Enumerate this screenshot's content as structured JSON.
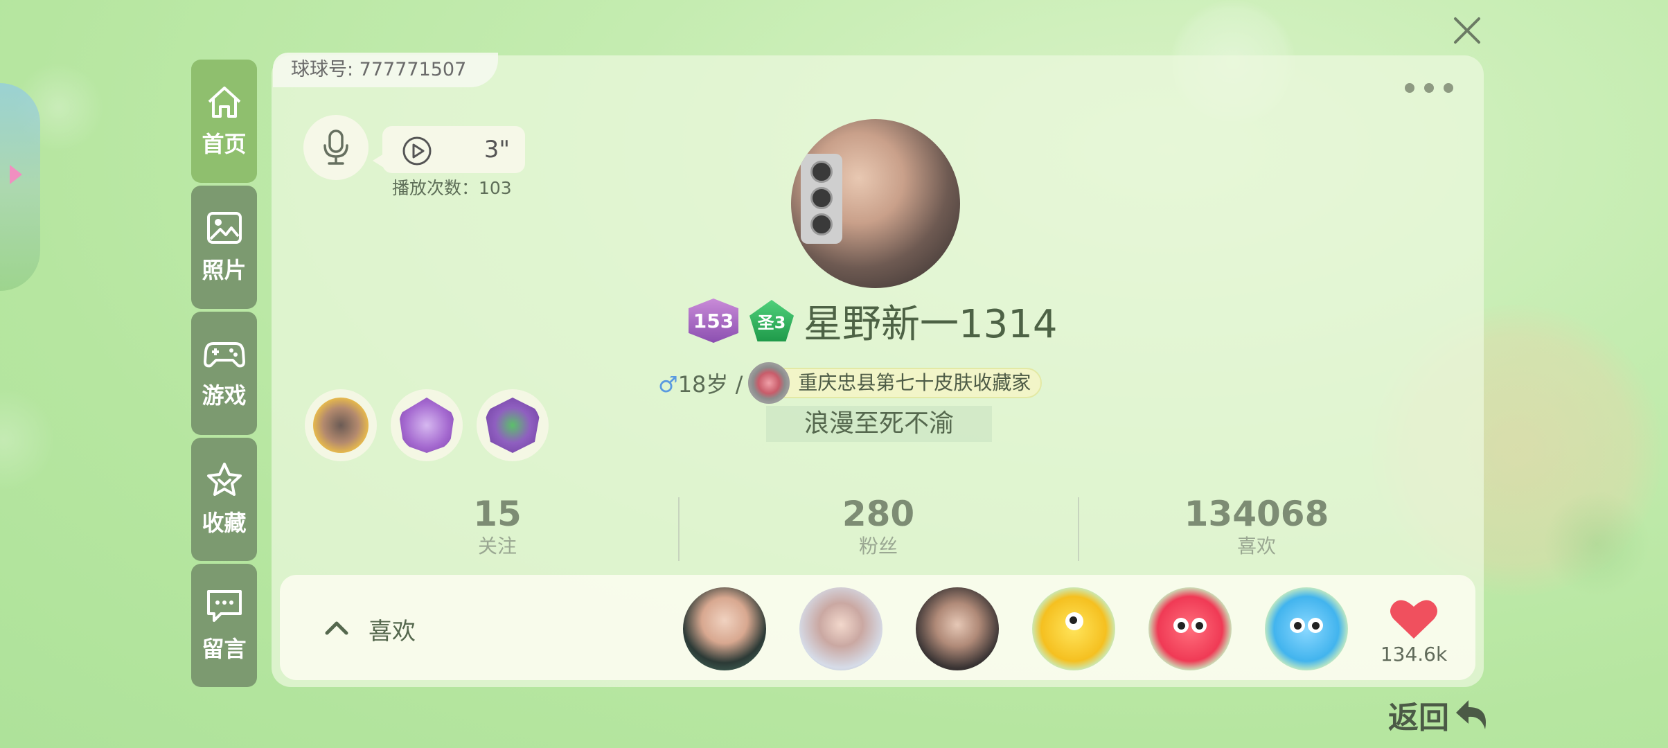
{
  "account": {
    "id_label": "球球号: 777771507"
  },
  "sidebar": {
    "items": [
      {
        "label": "首页",
        "icon": "home-icon",
        "active": true
      },
      {
        "label": "照片",
        "icon": "photo-icon",
        "active": false
      },
      {
        "label": "游戏",
        "icon": "gamepad-icon",
        "active": false
      },
      {
        "label": "收藏",
        "icon": "star-icon",
        "active": false
      },
      {
        "label": "留言",
        "icon": "message-icon",
        "active": false
      }
    ]
  },
  "voice": {
    "duration": "3\"",
    "play_count": "播放次数：103"
  },
  "profile": {
    "level": "153",
    "saint_badge": "圣3",
    "nickname": "星野新一1314",
    "gender_symbol": "♂",
    "age": "18岁 /",
    "title": "重庆忠县第七十皮肤收藏家",
    "signature": "浪漫至死不渝"
  },
  "stats": [
    {
      "value": "15",
      "label": "关注"
    },
    {
      "value": "280",
      "label": "粉丝"
    },
    {
      "value": "134068",
      "label": "喜欢"
    }
  ],
  "likes": {
    "label": "喜欢",
    "count": "134.6k"
  },
  "footer": {
    "back_label": "返回"
  },
  "colors": {
    "accent_green": "#8fbf6e",
    "sidebar_bg": "#7c9a70",
    "heart": "#f0505e"
  }
}
